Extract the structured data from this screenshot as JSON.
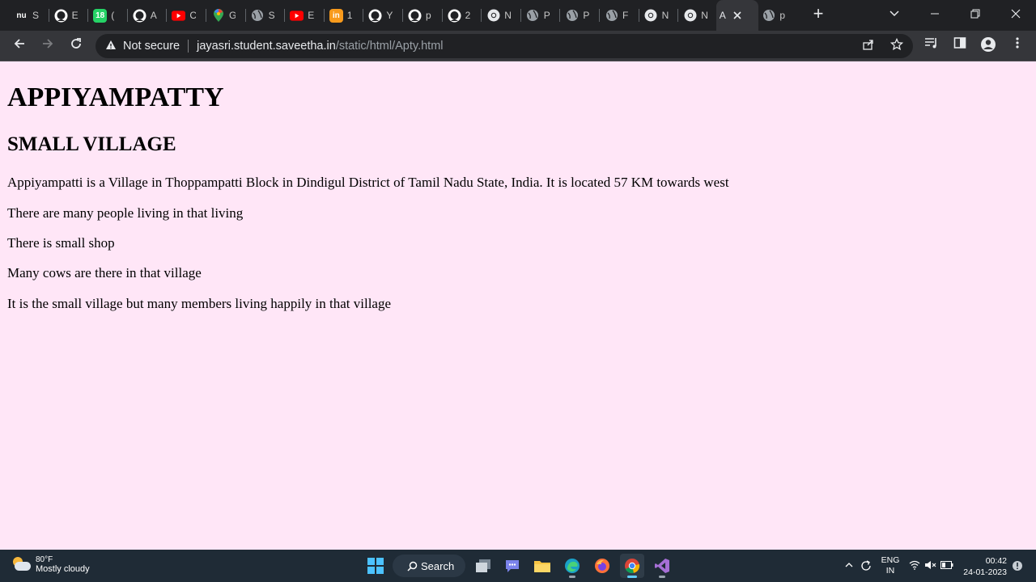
{
  "browser": {
    "tabs": [
      {
        "favicon": "nu",
        "title": "S",
        "color": "#202124"
      },
      {
        "favicon": "github-icon",
        "title": "E",
        "color": "#202124"
      },
      {
        "favicon": "18",
        "title": "(",
        "color": "#25d366"
      },
      {
        "favicon": "github-icon",
        "title": "A",
        "color": "#202124"
      },
      {
        "favicon": "youtube-icon",
        "title": "C",
        "color": "#ff0000"
      },
      {
        "favicon": "maps-pin-icon",
        "title": "G",
        "color": "#34a853"
      },
      {
        "favicon": "globe-icon",
        "title": "S",
        "color": "#9aa0a6"
      },
      {
        "favicon": "youtube-icon",
        "title": "E",
        "color": "#ff0000"
      },
      {
        "favicon": "in",
        "title": "1",
        "color": "#f89a1c"
      },
      {
        "favicon": "github-icon",
        "title": "Y",
        "color": "#202124"
      },
      {
        "favicon": "github-icon",
        "title": "p",
        "color": "#202124"
      },
      {
        "favicon": "github-icon",
        "title": "2",
        "color": "#202124"
      },
      {
        "favicon": "chrome-icon",
        "title": "N",
        "color": "#9aa0a6"
      },
      {
        "favicon": "globe-icon",
        "title": "P",
        "color": "#9aa0a6"
      },
      {
        "favicon": "globe-icon",
        "title": "P",
        "color": "#9aa0a6"
      },
      {
        "favicon": "globe-icon",
        "title": "F",
        "color": "#9aa0a6"
      },
      {
        "favicon": "chrome-icon",
        "title": "N",
        "color": "#9aa0a6"
      },
      {
        "favicon": "chrome-icon",
        "title": "N",
        "color": "#9aa0a6"
      },
      {
        "favicon": "",
        "title": "A",
        "color": "#9aa0a6",
        "active": true
      },
      {
        "favicon": "globe-icon",
        "title": "p",
        "color": "#9aa0a6"
      }
    ],
    "not_secure_label": "Not secure",
    "url_host": "jayasri.student.saveetha.in",
    "url_path": "/static/html/Apty.html"
  },
  "page": {
    "heading": "APPIYAMPATTY",
    "subheading": "SMALL VILLAGE",
    "paragraphs": [
      "Appiyampatti is a Village in Thoppampatti Block in Dindigul District of Tamil Nadu State, India. It is located 57 KM towards west",
      "There are many people living in that living",
      "There is small shop",
      "Many cows are there in that village",
      "It is the small village but many members living happily in that village"
    ],
    "background_color": "#ffe6f7"
  },
  "taskbar": {
    "weather_temp": "80°F",
    "weather_desc": "Mostly cloudy",
    "search_label": "Search",
    "lang_line1": "ENG",
    "lang_line2": "IN",
    "time": "00:42",
    "date": "24-01-2023"
  }
}
